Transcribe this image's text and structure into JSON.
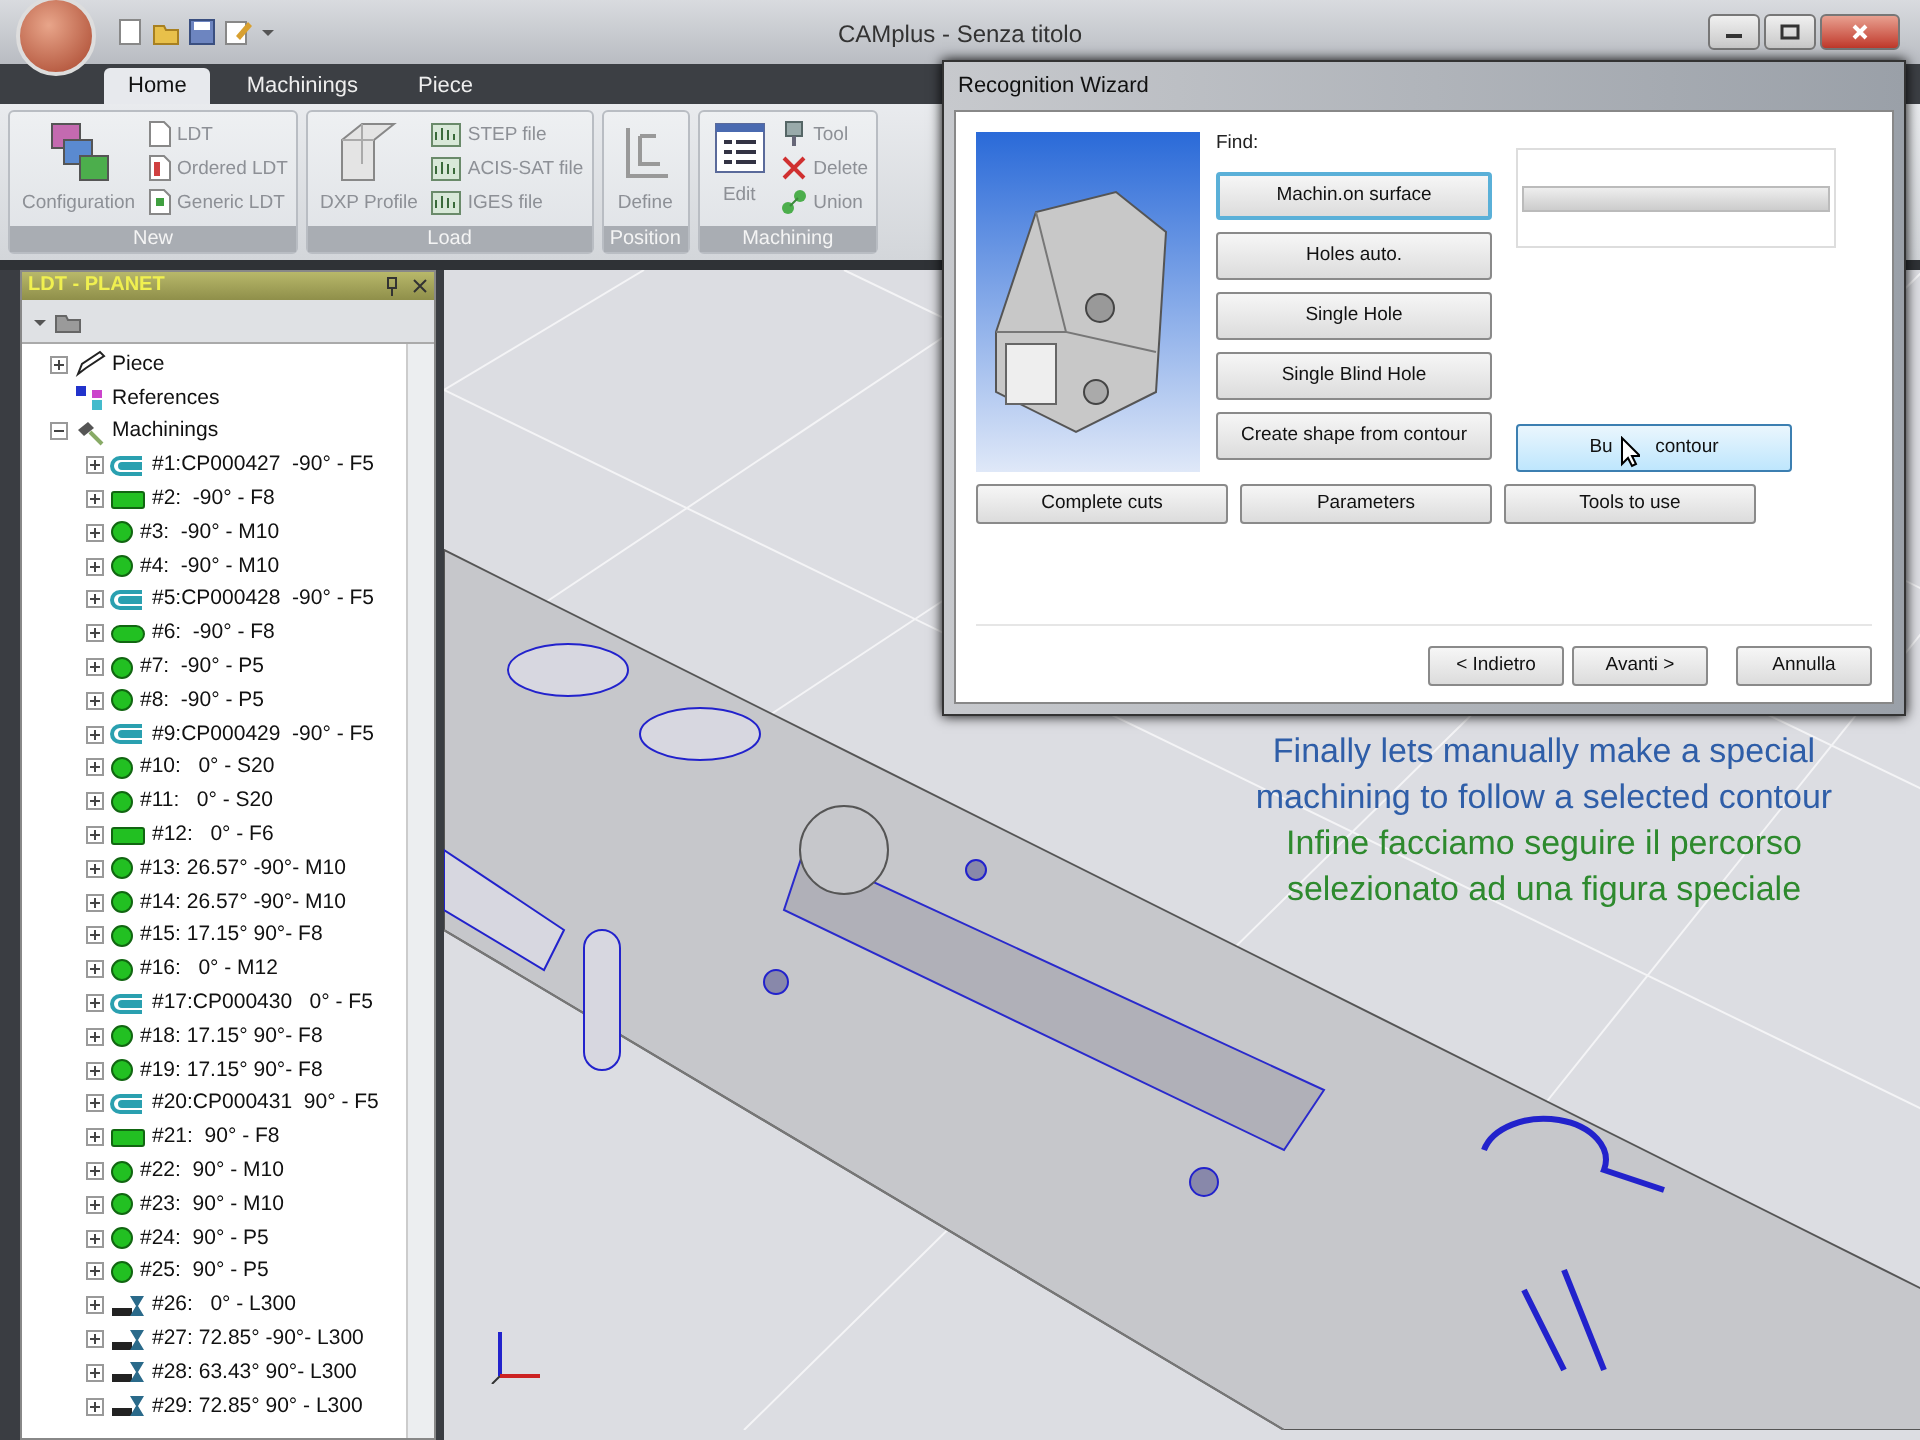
{
  "window": {
    "title": "CAMplus - Senza titolo"
  },
  "tabs": [
    {
      "label": "Home",
      "selected": true
    },
    {
      "label": "Machinings",
      "selected": false
    },
    {
      "label": "Piece",
      "selected": false
    }
  ],
  "ribbon": {
    "groups": [
      {
        "label": "New",
        "items": [
          {
            "label": "Configuration",
            "kind": "large"
          },
          {
            "label": "LDT",
            "kind": "small"
          },
          {
            "label": "Ordered LDT",
            "kind": "small"
          },
          {
            "label": "Generic LDT",
            "kind": "small"
          }
        ]
      },
      {
        "label": "Load",
        "items": [
          {
            "label": "DXP Profile",
            "kind": "large"
          },
          {
            "label": "STEP file",
            "kind": "small"
          },
          {
            "label": "ACIS-SAT file",
            "kind": "small"
          },
          {
            "label": "IGES file",
            "kind": "small"
          }
        ]
      },
      {
        "label": "Position",
        "items": [
          {
            "label": "Define",
            "kind": "large"
          }
        ]
      },
      {
        "label": "Machining",
        "items": [
          {
            "label": "Edit",
            "kind": "large"
          },
          {
            "label": "Tool",
            "kind": "small"
          },
          {
            "label": "Delete",
            "kind": "small"
          },
          {
            "label": "Union",
            "kind": "small"
          }
        ]
      }
    ]
  },
  "panel": {
    "title": "LDT - PLANET",
    "tree": [
      {
        "label": "Piece",
        "kind": "piece",
        "expanded": false
      },
      {
        "label": "References",
        "kind": "references"
      },
      {
        "label": "Machinings",
        "kind": "machinings",
        "expanded": true,
        "children": [
          {
            "label": "#1:CP000427  -90° - F5",
            "kind": "contour",
            "expanded": false
          },
          {
            "label": "#2:  -90° - F8",
            "kind": "pocket",
            "expanded": false
          },
          {
            "label": "#3:  -90° - M10",
            "kind": "hole",
            "expanded": false
          },
          {
            "label": "#4:  -90° - M10",
            "kind": "hole",
            "expanded": false
          },
          {
            "label": "#5:CP000428  -90° - F5",
            "kind": "contour",
            "expanded": false
          },
          {
            "label": "#6:  -90° - F8",
            "kind": "slot",
            "expanded": false
          },
          {
            "label": "#7:  -90° - P5",
            "kind": "hole",
            "expanded": false
          },
          {
            "label": "#8:  -90° - P5",
            "kind": "hole",
            "expanded": false
          },
          {
            "label": "#9:CP000429  -90° - F5",
            "kind": "contour",
            "expanded": false
          },
          {
            "label": "#10:   0° - S20",
            "kind": "hole",
            "expanded": false
          },
          {
            "label": "#11:   0° - S20",
            "kind": "hole",
            "expanded": false
          },
          {
            "label": "#12:   0° - F6",
            "kind": "pocket",
            "expanded": false
          },
          {
            "label": "#13: 26.57° -90°- M10",
            "kind": "hole",
            "expanded": false
          },
          {
            "label": "#14: 26.57° -90°- M10",
            "kind": "hole",
            "expanded": false
          },
          {
            "label": "#15: 17.15° 90°- F8",
            "kind": "hole",
            "expanded": false
          },
          {
            "label": "#16:   0° - M12",
            "kind": "hole",
            "expanded": false
          },
          {
            "label": "#17:CP000430   0° - F5",
            "kind": "contour",
            "expanded": false
          },
          {
            "label": "#18: 17.15° 90°- F8",
            "kind": "hole",
            "expanded": false
          },
          {
            "label": "#19: 17.15° 90°- F8",
            "kind": "hole",
            "expanded": false
          },
          {
            "label": "#20:CP000431  90° - F5",
            "kind": "contour",
            "expanded": false
          },
          {
            "label": "#21:  90° - F8",
            "kind": "pocket",
            "expanded": false
          },
          {
            "label": "#22:  90° - M10",
            "kind": "hole",
            "expanded": false
          },
          {
            "label": "#23:  90° - M10",
            "kind": "hole",
            "expanded": false
          },
          {
            "label": "#24:  90° - P5",
            "kind": "hole",
            "expanded": false
          },
          {
            "label": "#25:  90° - P5",
            "kind": "hole",
            "expanded": false
          },
          {
            "label": "#26:   0° - L300",
            "kind": "saw",
            "expanded": false
          },
          {
            "label": "#27: 72.85° -90°- L300",
            "kind": "saw",
            "expanded": false
          },
          {
            "label": "#28: 63.43° 90°- L300",
            "kind": "saw",
            "expanded": false
          },
          {
            "label": "#29: 72.85° 90° - L300",
            "kind": "saw",
            "expanded": false
          }
        ]
      }
    ]
  },
  "dialog": {
    "title": "Recognition Wizard",
    "find_label": "Find:",
    "find_buttons": [
      {
        "label": "Machin.on surface",
        "focused": true,
        "hot": false
      },
      {
        "label": "Holes auto.",
        "focused": false,
        "hot": false
      },
      {
        "label": "Single Hole",
        "focused": false,
        "hot": false
      },
      {
        "label": "Single Blind Hole",
        "focused": false,
        "hot": false
      },
      {
        "label": "Create shape from contour",
        "focused": false,
        "hot": false
      }
    ],
    "side_button": {
      "label": "Bu  contour",
      "focused": false,
      "hot": true
    },
    "progress": {
      "level": 0
    },
    "option_buttons": [
      "Complete cuts",
      "Parameters",
      "Tools to use"
    ],
    "nav_buttons": [
      "< Indietro",
      "Avanti >",
      "Annulla"
    ]
  },
  "caption": [
    {
      "text": "Finally lets manually make a special",
      "kind": "english"
    },
    {
      "text": "machining to follow a selected contour",
      "kind": "english"
    },
    {
      "text": "Infine facciamo seguire il percorso",
      "kind": "italian"
    },
    {
      "text": "selezionato ad una figura speciale",
      "kind": "italian"
    }
  ]
}
